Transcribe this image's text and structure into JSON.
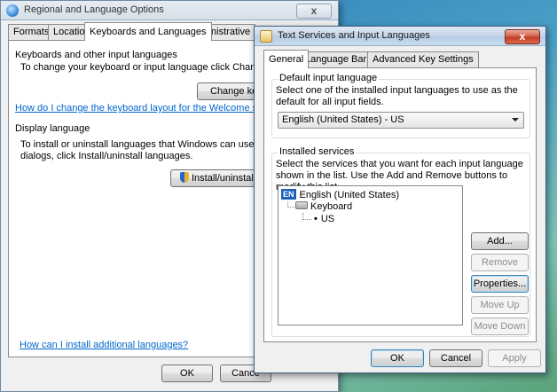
{
  "colors": {
    "link": "#0066cc",
    "close_button": "#c9432a",
    "language_icon_bg": "#1c5fb8"
  },
  "regional_window": {
    "title": "Regional and Language Options",
    "tabs": [
      {
        "label": "Formats"
      },
      {
        "label": "Location"
      },
      {
        "label": "Keyboards and Languages"
      },
      {
        "label": "Administrative"
      }
    ],
    "keyboards_group": {
      "label": "Keyboards and other input languages",
      "description": "To change your keyboard or input language click Change ke",
      "change_button": "Change ke",
      "help_link": "How do I change the keyboard layout for the Welcome scree"
    },
    "display_group": {
      "label": "Display language",
      "description_line1": "To install or uninstall languages that Windows can use in m",
      "description_line2": "dialogs, click Install/uninstall languages.",
      "install_button": "Install/uninstall"
    },
    "bottom_link": "How can I install additional languages?",
    "ok_button": "OK",
    "cancel_button": "Cance"
  },
  "text_services_window": {
    "title": "Text Services and Input Languages",
    "close_glyph": "x",
    "tabs": [
      {
        "label": "General"
      },
      {
        "label": "Language Bar"
      },
      {
        "label": "Advanced Key Settings"
      }
    ],
    "default_input": {
      "label": "Default input language",
      "description": "Select one of the installed input languages to use as the default for all input fields.",
      "selected_value": "English (United States) - US"
    },
    "installed_services": {
      "label": "Installed services",
      "description": "Select the services that you want for each input language shown in the list. Use the Add and Remove buttons to modify this list.",
      "tree": {
        "language_code": "EN",
        "language": "English (United States)",
        "category": "Keyboard",
        "layout_bullet": "•",
        "layout": "US"
      },
      "buttons": {
        "add": "Add...",
        "remove": "Remove",
        "properties": "Properties...",
        "move_up": "Move Up",
        "move_down": "Move Down"
      }
    },
    "ok_button": "OK",
    "cancel_button": "Cancel",
    "apply_button": "Apply"
  }
}
